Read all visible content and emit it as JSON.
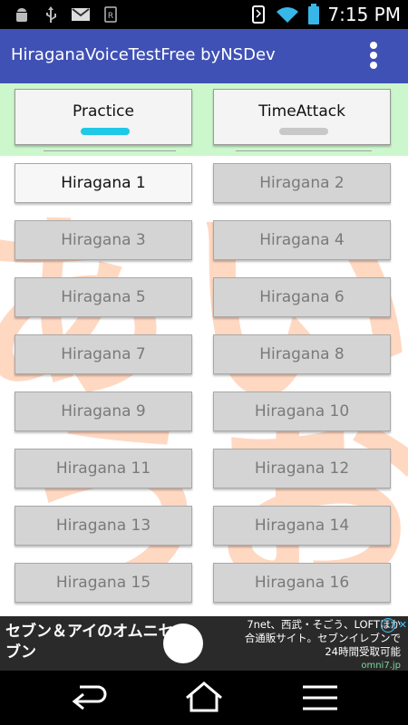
{
  "status_bar": {
    "time": "7:15 PM",
    "icons": [
      "android-icon",
      "usb-icon",
      "gmail-icon",
      "notification-icon",
      "vibrate-icon",
      "wifi-icon",
      "battery-icon"
    ]
  },
  "app_bar": {
    "title": "HiraganaVoiceTestFree byNSDev",
    "menu_icon": "overflow-menu-icon"
  },
  "modes": {
    "practice": {
      "label": "Practice",
      "indicator_color": "#1ec8e6",
      "selected": true
    },
    "time_attack": {
      "label": "TimeAttack",
      "indicator_color": "#c8c8c8",
      "selected": false
    }
  },
  "levels": [
    {
      "label": "Hiragana 1",
      "active": true
    },
    {
      "label": "Hiragana 2",
      "active": false
    },
    {
      "label": "Hiragana 3",
      "active": false
    },
    {
      "label": "Hiragana 4",
      "active": false
    },
    {
      "label": "Hiragana 5",
      "active": false
    },
    {
      "label": "Hiragana 6",
      "active": false
    },
    {
      "label": "Hiragana 7",
      "active": false
    },
    {
      "label": "Hiragana 8",
      "active": false
    },
    {
      "label": "Hiragana 9",
      "active": false
    },
    {
      "label": "Hiragana 10",
      "active": false
    },
    {
      "label": "Hiragana 11",
      "active": false
    },
    {
      "label": "Hiragana 12",
      "active": false
    },
    {
      "label": "Hiragana 13",
      "active": false
    },
    {
      "label": "Hiragana 14",
      "active": false
    },
    {
      "label": "Hiragana 15",
      "active": false
    },
    {
      "label": "Hiragana 16",
      "active": false
    }
  ],
  "background_chars": [
    "あ",
    "い",
    "う",
    "お"
  ],
  "ad": {
    "left_text": "セブン＆アイのオムニセブン",
    "right_text_line1": "7net、西武・そごう、LOFTほか",
    "right_text_line2": "合通販サイト。セブンイレブンで",
    "right_text_line3": "24時間受取可能",
    "brand": "omni7.jp",
    "info_icon": "ⓘ",
    "close_icon": "✕"
  },
  "nav_bar": {
    "back_icon": "back-icon",
    "home_icon": "home-icon",
    "recents_icon": "recents-menu-icon"
  },
  "colors": {
    "app_bar": "#3f51b5",
    "mode_bar": "#ccf7cc",
    "active_indicator": "#1ec8e6",
    "bg_char": "#ffd2b8"
  }
}
